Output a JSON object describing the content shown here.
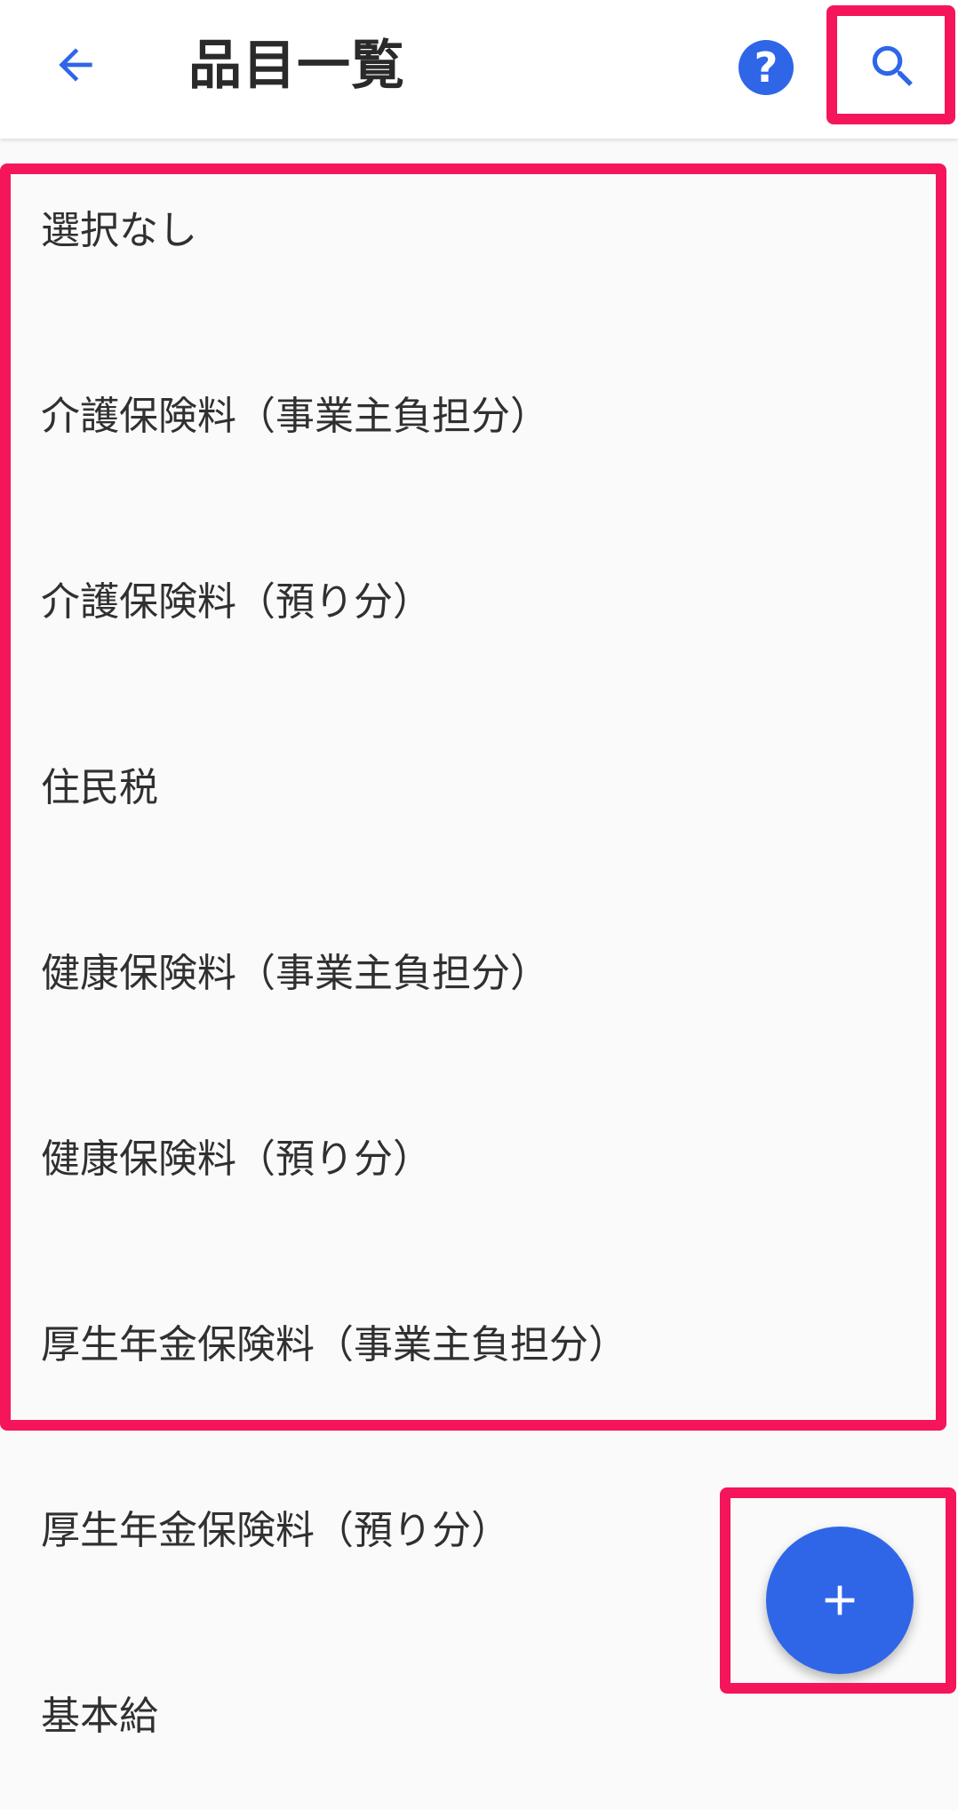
{
  "app_bar": {
    "title": "品目一覧",
    "back_icon": "arrow-back-icon",
    "help_icon": "help-circle-icon",
    "help_glyph": "?",
    "search_icon": "search-icon"
  },
  "items": [
    "選択なし",
    "介護保険料（事業主負担分）",
    "介護保険料（預り分）",
    "住民税",
    "健康保険料（事業主負担分）",
    "健康保険料（預り分）",
    "厚生年金保険料（事業主負担分）",
    "厚生年金保険料（預り分）",
    "基本給"
  ],
  "fab": {
    "icon": "plus-icon"
  },
  "colors": {
    "accent": "#2f66e8",
    "highlight": "#f5155a",
    "text": "#303030",
    "background": "#fafafa"
  }
}
